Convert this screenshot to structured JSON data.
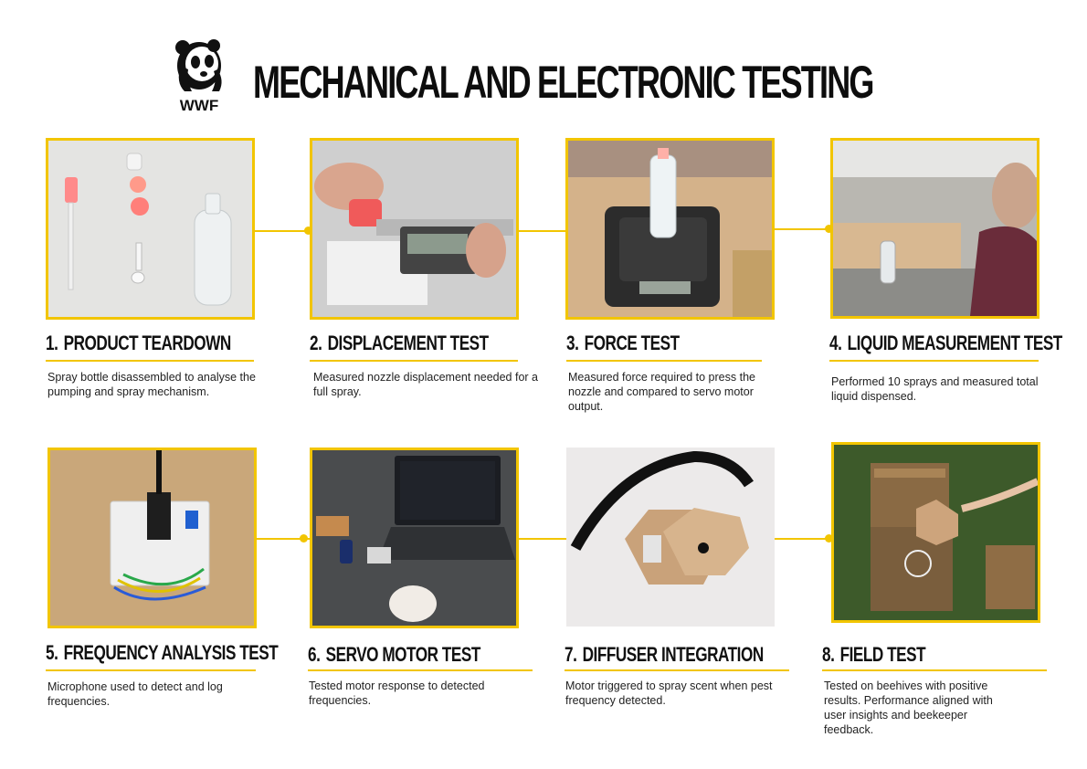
{
  "header": {
    "logo_text": "WWF",
    "title": "MECHANICAL AND ELECTRONIC TESTING"
  },
  "colors": {
    "accent": "#f2c500",
    "text": "#111111"
  },
  "steps": [
    {
      "number": "1.",
      "title": "PRODUCT TEARDOWN",
      "description": "Spray bottle disassembled to analyse the pumping and spray mechanism."
    },
    {
      "number": "2.",
      "title": "DISPLACEMENT TEST",
      "description": "Measured nozzle displacement needed for a full spray."
    },
    {
      "number": "3.",
      "title": "FORCE TEST",
      "description": "Measured force required to press the nozzle and compared to servo motor output."
    },
    {
      "number": "4.",
      "title": "LIQUID MEASUREMENT TEST",
      "description": "Performed 10 sprays and measured total liquid dispensed."
    },
    {
      "number": "5.",
      "title": "FREQUENCY ANALYSIS TEST",
      "description": "Microphone used to detect and log frequencies."
    },
    {
      "number": "6.",
      "title": "SERVO MOTOR TEST",
      "description": "Tested motor response to detected frequencies."
    },
    {
      "number": "7.",
      "title": "DIFFUSER INTEGRATION",
      "description": "Motor triggered to spray scent when pest frequency detected."
    },
    {
      "number": "8.",
      "title": "FIELD TEST",
      "description": "Tested on beehives with positive results. Performance aligned with user insights and beekeeper feedback."
    }
  ]
}
